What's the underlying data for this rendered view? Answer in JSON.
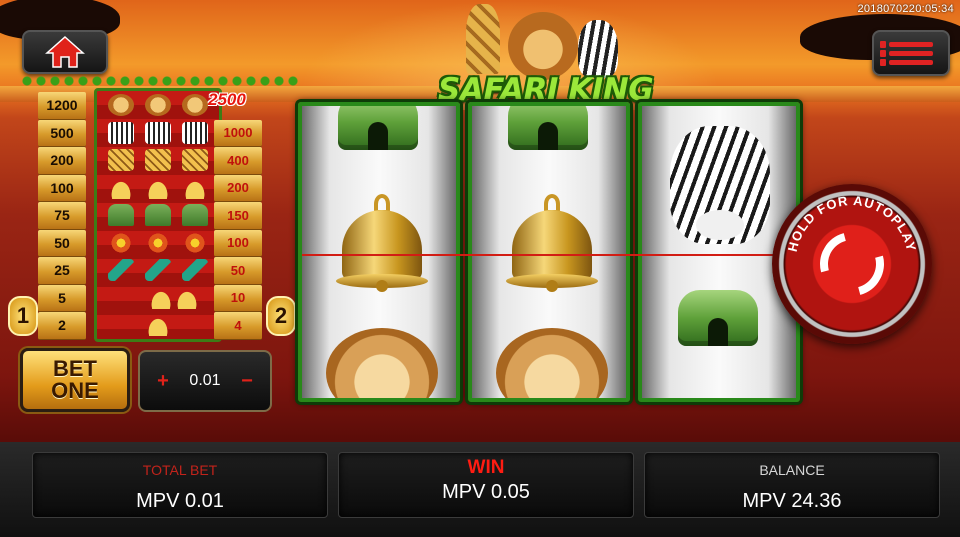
{
  "status": {
    "timestamp": "2018070220:05:34"
  },
  "header": {
    "logo_text": "SAFARI KING",
    "home_icon": "home-icon",
    "menu_icon": "menu-icon"
  },
  "paytable": {
    "left_values": [
      "1200",
      "500",
      "200",
      "100",
      "75",
      "50",
      "25",
      "5",
      "2"
    ],
    "right_values": [
      "2500",
      "1000",
      "400",
      "200",
      "150",
      "100",
      "50",
      "10",
      "4"
    ],
    "symbol_rows": [
      "lion",
      "zebra",
      "giraffe",
      "bell",
      "hut",
      "flower",
      "feather",
      "bell",
      "bell"
    ],
    "coin_badges": [
      "1",
      "2"
    ]
  },
  "controls": {
    "bet_one_line1": "BET",
    "bet_one_line2": "ONE",
    "stake_minus": "+",
    "stake_value": "0.01",
    "stake_plus": "−"
  },
  "reels": [
    {
      "top": "hut",
      "middle": "bell",
      "bottom": "lion"
    },
    {
      "top": "hut",
      "middle": "bell",
      "bottom": "lion"
    },
    {
      "top": "zebra",
      "middle": "",
      "bottom": "hut"
    }
  ],
  "autoplay": {
    "label": "HOLD FOR AUTOPLAY",
    "icon": "refresh-icon"
  },
  "footer": {
    "total_bet_label": "TOTAL BET",
    "total_bet_value": "MPV 0.01",
    "win_label": "WIN",
    "win_value": "MPV 0.05",
    "balance_label": "BALANCE",
    "balance_value": "MPV 24.36"
  }
}
